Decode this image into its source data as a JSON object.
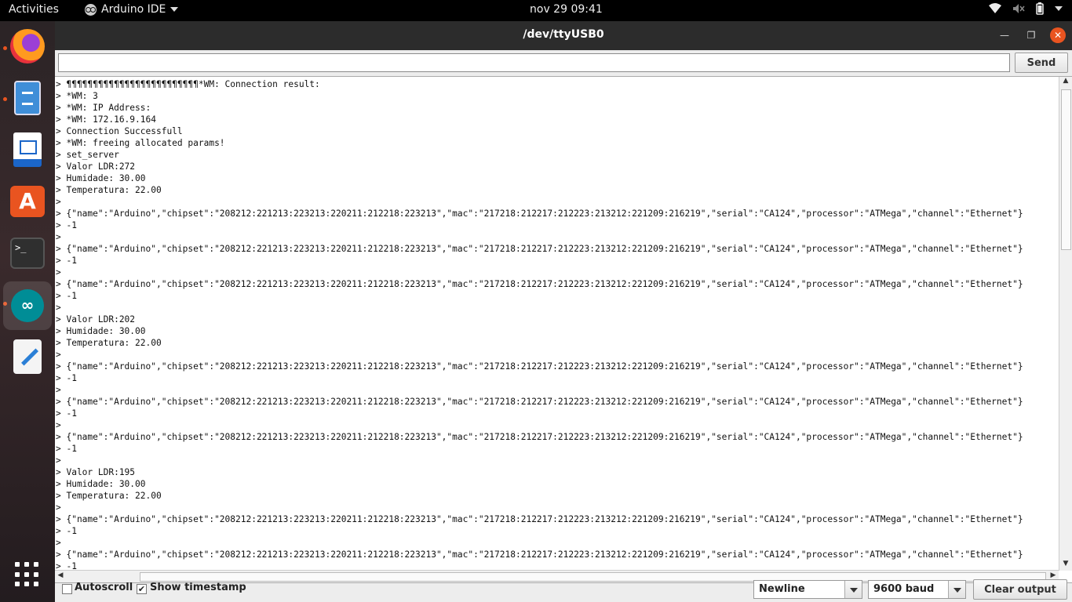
{
  "topbar": {
    "activities": "Activities",
    "app_name": "Arduino IDE",
    "clock": "nov 29  09:41",
    "tray_icons": [
      "wifi-icon",
      "volume-muted-icon",
      "battery-icon",
      "power-menu-icon"
    ]
  },
  "dock": {
    "items": [
      "firefox",
      "files",
      "libreoffice-writer",
      "ubuntu-software",
      "terminal",
      "arduino-ide",
      "text-editor",
      "show-applications"
    ]
  },
  "window": {
    "title": "/dev/ttyUSB0",
    "send_input": {
      "value": "",
      "placeholder": ""
    },
    "send_label": "Send",
    "output_lines": [
      "> ¶¶¶¶¶¶¶¶¶¶¶¶¶¶¶¶¶¶¶¶¶¶¶¶¶*WM: Connection result:",
      "> *WM: 3",
      "> *WM: IP Address:",
      "> *WM: 172.16.9.164",
      "> Connection Successfull",
      "> *WM: freeing allocated params!",
      "> set_server",
      "> Valor LDR:272",
      "> Humidade: 30.00",
      "> Temperatura: 22.00",
      ">",
      "> {\"name\":\"Arduino\",\"chipset\":\"208212:221213:223213:220211:212218:223213\",\"mac\":\"217218:212217:212223:213212:221209:216219\",\"serial\":\"CA124\",\"processor\":\"ATMega\",\"channel\":\"Ethernet\"}",
      "> -1",
      ">",
      "> {\"name\":\"Arduino\",\"chipset\":\"208212:221213:223213:220211:212218:223213\",\"mac\":\"217218:212217:212223:213212:221209:216219\",\"serial\":\"CA124\",\"processor\":\"ATMega\",\"channel\":\"Ethernet\"}",
      "> -1",
      ">",
      "> {\"name\":\"Arduino\",\"chipset\":\"208212:221213:223213:220211:212218:223213\",\"mac\":\"217218:212217:212223:213212:221209:216219\",\"serial\":\"CA124\",\"processor\":\"ATMega\",\"channel\":\"Ethernet\"}",
      "> -1",
      ">",
      "> Valor LDR:202",
      "> Humidade: 30.00",
      "> Temperatura: 22.00",
      ">",
      "> {\"name\":\"Arduino\",\"chipset\":\"208212:221213:223213:220211:212218:223213\",\"mac\":\"217218:212217:212223:213212:221209:216219\",\"serial\":\"CA124\",\"processor\":\"ATMega\",\"channel\":\"Ethernet\"}",
      "> -1",
      ">",
      "> {\"name\":\"Arduino\",\"chipset\":\"208212:221213:223213:220211:212218:223213\",\"mac\":\"217218:212217:212223:213212:221209:216219\",\"serial\":\"CA124\",\"processor\":\"ATMega\",\"channel\":\"Ethernet\"}",
      "> -1",
      ">",
      "> {\"name\":\"Arduino\",\"chipset\":\"208212:221213:223213:220211:212218:223213\",\"mac\":\"217218:212217:212223:213212:221209:216219\",\"serial\":\"CA124\",\"processor\":\"ATMega\",\"channel\":\"Ethernet\"}",
      "> -1",
      ">",
      "> Valor LDR:195",
      "> Humidade: 30.00",
      "> Temperatura: 22.00",
      ">",
      "> {\"name\":\"Arduino\",\"chipset\":\"208212:221213:223213:220211:212218:223213\",\"mac\":\"217218:212217:212223:213212:221209:216219\",\"serial\":\"CA124\",\"processor\":\"ATMega\",\"channel\":\"Ethernet\"}",
      "> -1",
      ">",
      "> {\"name\":\"Arduino\",\"chipset\":\"208212:221213:223213:220211:212218:223213\",\"mac\":\"217218:212217:212223:213212:221209:216219\",\"serial\":\"CA124\",\"processor\":\"ATMega\",\"channel\":\"Ethernet\"}",
      "> -1"
    ],
    "autoscroll": {
      "label": "Autoscroll",
      "checked": false
    },
    "show_timestamp": {
      "label": "Show timestamp",
      "checked": true
    },
    "line_ending": "Newline",
    "baud_rate": "9600 baud",
    "clear_label": "Clear output"
  },
  "colors": {
    "accent": "#e95420",
    "titlebar": "#2c2c2c",
    "topbar": "#000000"
  }
}
